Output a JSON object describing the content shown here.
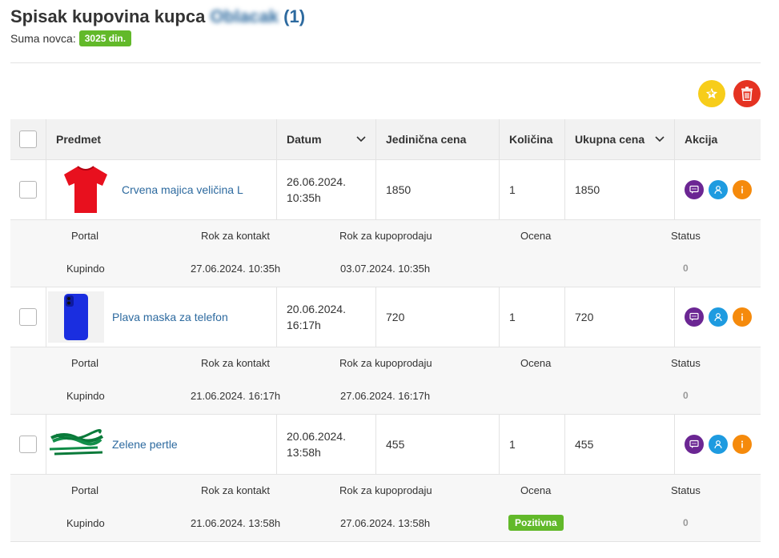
{
  "header": {
    "title_prefix": "Spisak kupovina kupca",
    "buyer_name": "Oblacak",
    "count": "(1)",
    "sum_label": "Suma novca:",
    "sum_value": "3025 din."
  },
  "toolbar": {
    "favorite_icon": "star-plus-icon",
    "delete_icon": "trash-icon"
  },
  "table": {
    "columns": [
      "Predmet",
      "Datum",
      "Jedinična cena",
      "Količina",
      "Ukupna cena",
      "Akcija"
    ],
    "detail_labels": [
      "Portal",
      "Rok za kontakt",
      "Rok za kupoprodaju",
      "Ocena",
      "Status"
    ],
    "rows": [
      {
        "name": "Crvena majica veličina L",
        "date_line1": "26.06.2024.",
        "date_line2": "10:35h",
        "unit_price": "1850",
        "quantity": "1",
        "total": "1850",
        "portal": "Kupindo",
        "contact_deadline": "27.06.2024. 10:35h",
        "sale_deadline": "03.07.2024. 10:35h",
        "rating": "",
        "status": "0"
      },
      {
        "name": "Plava maska za telefon",
        "date_line1": "20.06.2024.",
        "date_line2": "16:17h",
        "unit_price": "720",
        "quantity": "1",
        "total": "720",
        "portal": "Kupindo",
        "contact_deadline": "21.06.2024. 16:17h",
        "sale_deadline": "27.06.2024. 16:17h",
        "rating": "",
        "status": "0"
      },
      {
        "name": "Zelene pertle",
        "date_line1": "20.06.2024.",
        "date_line2": "13:58h",
        "unit_price": "455",
        "quantity": "1",
        "total": "455",
        "portal": "Kupindo",
        "contact_deadline": "21.06.2024. 13:58h",
        "sale_deadline": "27.06.2024. 13:58h",
        "rating": "Pozitivna",
        "status": "0"
      }
    ]
  },
  "colors": {
    "link": "#2d6a9f",
    "green": "#62b92a",
    "yellow": "#f7cd1a",
    "red": "#e53322",
    "purple": "#6b2693",
    "blue": "#1e9be0",
    "orange": "#f58a0c"
  }
}
